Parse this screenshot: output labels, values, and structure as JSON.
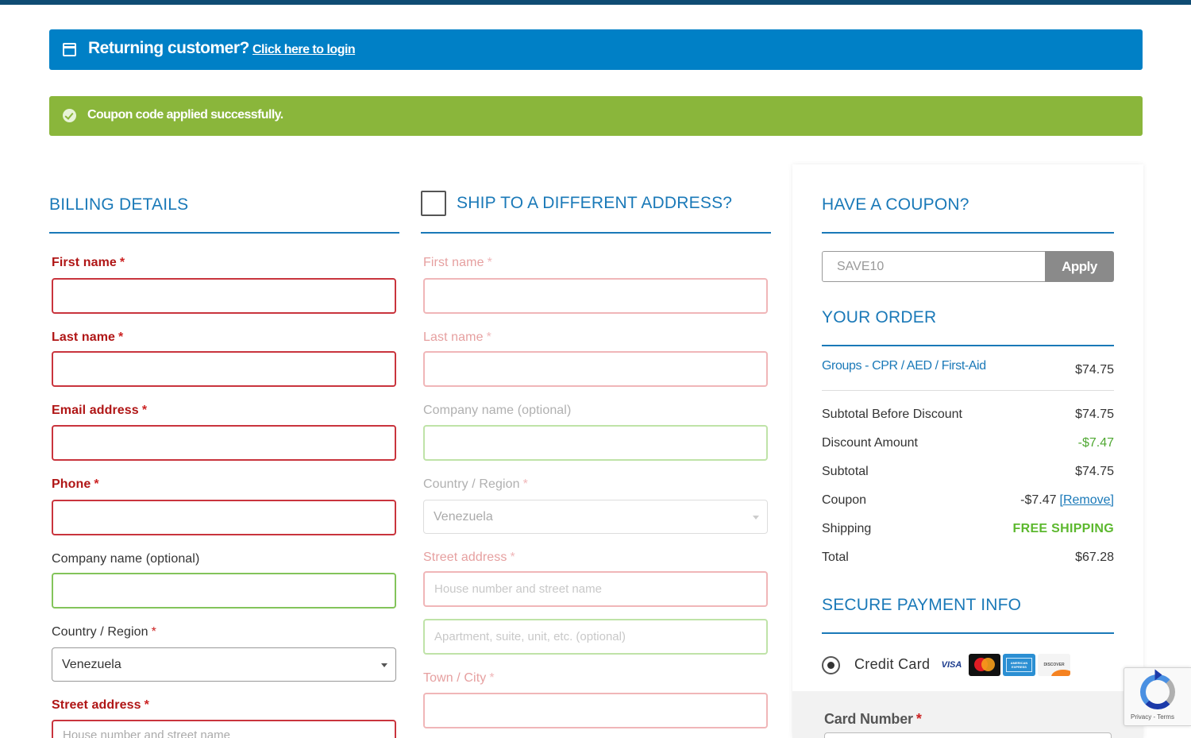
{
  "notices": {
    "login_title": "Returning customer?",
    "login_link": "Click here to login",
    "coupon_success": "Coupon code applied successfully."
  },
  "billing": {
    "title": "BILLING DETAILS",
    "first_name_label": "First name",
    "last_name_label": "Last name",
    "email_label": "Email address",
    "phone_label": "Phone",
    "company_label": "Company name (optional)",
    "country_label": "Country / Region",
    "country_value": "Venezuela",
    "street_label": "Street address",
    "street_placeholder": "House number and street name",
    "required_mark": "*"
  },
  "shipping": {
    "title": "SHIP TO A DIFFERENT ADDRESS?",
    "first_name_label": "First name",
    "last_name_label": "Last name",
    "company_label": "Company name (optional)",
    "country_label": "Country / Region",
    "country_value": "Venezuela",
    "street_label": "Street address",
    "street_placeholder": "House number and street name",
    "apartment_placeholder": "Apartment, suite, unit, etc. (optional)",
    "city_label": "Town / City"
  },
  "coupon": {
    "title": "HAVE A COUPON?",
    "code_value": "SAVE10",
    "apply_label": "Apply"
  },
  "order": {
    "title": "YOUR ORDER",
    "item_name": "Groups - CPR / AED / First-Aid",
    "item_price": "$74.75",
    "rows": [
      {
        "label": "Subtotal Before Discount",
        "value": "$74.75"
      },
      {
        "label": "Discount Amount",
        "value": "-$7.47"
      },
      {
        "label": "Subtotal",
        "value": "$74.75"
      },
      {
        "label": "Coupon",
        "value": "-$7.47"
      },
      {
        "label": "Shipping",
        "value": "FREE SHIPPING"
      },
      {
        "label": "Total",
        "value": "$67.28"
      }
    ],
    "remove_link": "[Remove]"
  },
  "payment": {
    "title": "SECURE PAYMENT INFO",
    "method_label": "Credit Card",
    "card_logos": [
      "visa-logo",
      "mastercard-logo",
      "amex-logo",
      "discover-logo"
    ],
    "visa_text": "VISA",
    "amex_text": "AMERICAN EXPRESS",
    "discover_text": "DISCOVER",
    "card_number_label": "Card Number"
  },
  "recaptcha": {
    "terms_text": "Privacy - Terms"
  },
  "colors": {
    "primary_blue": "#0080c6",
    "heading_blue": "#1a79b8",
    "success_green": "#8ab63b",
    "error_red": "#c9343d"
  }
}
